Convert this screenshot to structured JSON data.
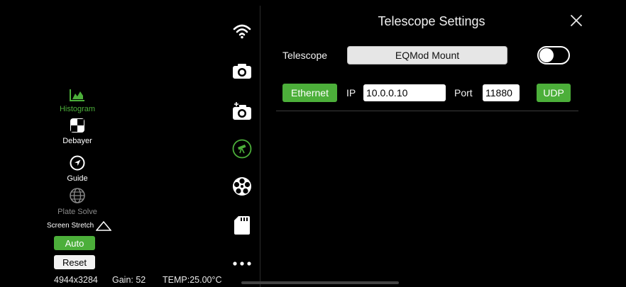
{
  "tools": {
    "histogram": "Histogram",
    "debayer": "Debayer",
    "guide": "Guide",
    "plate_solve": "Plate Solve",
    "screen_stretch": "Screen Stretch",
    "auto": "Auto",
    "reset": "Reset"
  },
  "status": {
    "resolution": "4944x3284",
    "gain": "Gain: 52",
    "temp": "TEMP:25.00°C"
  },
  "icons": [
    "wifi-icon",
    "camera-icon",
    "camera-plus-icon",
    "telescope-icon",
    "filter-wheel-icon",
    "sd-card-icon",
    "more-icon"
  ],
  "panel": {
    "title": "Telescope Settings",
    "telescope_label": "Telescope",
    "telescope_value": "EQMod Mount",
    "toggle_on": false,
    "connection_button": "Ethernet",
    "ip_label": "IP",
    "ip_value": "10.0.0.10",
    "port_label": "Port",
    "port_value": "11880",
    "protocol_button": "UDP"
  },
  "colors": {
    "accent": "#4caf3a",
    "background": "#000000"
  }
}
